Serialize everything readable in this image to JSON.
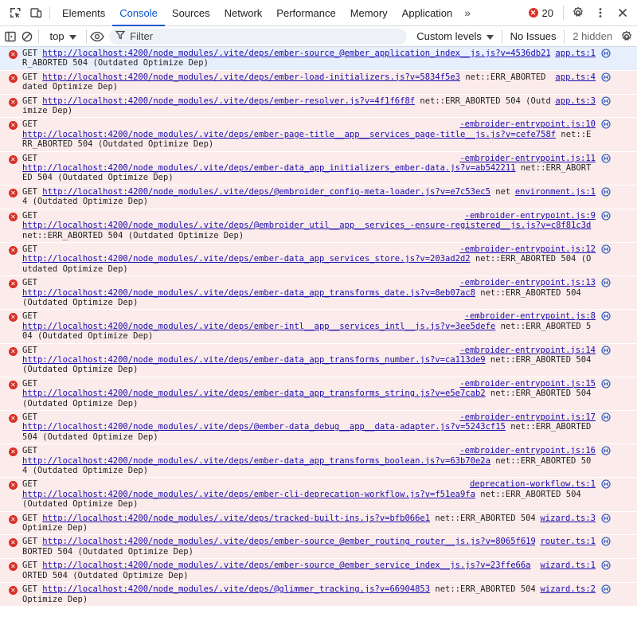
{
  "tabs": [
    {
      "label": "Elements",
      "active": false
    },
    {
      "label": "Console",
      "active": true
    },
    {
      "label": "Sources",
      "active": false
    },
    {
      "label": "Network",
      "active": false
    },
    {
      "label": "Performance",
      "active": false
    },
    {
      "label": "Memory",
      "active": false
    },
    {
      "label": "Application",
      "active": false
    }
  ],
  "topbar": {
    "more_tabs": "»",
    "error_count": "20",
    "icons": [
      "inspect-element-icon",
      "device-toolbar-icon",
      "settings-icon",
      "more-vert-icon",
      "close-icon"
    ]
  },
  "toolbar": {
    "context": "top",
    "filter_placeholder": "Filter",
    "levels": "Custom levels",
    "issues": "No Issues",
    "hidden": "2 hidden"
  },
  "colors": {
    "accent": "#0b57d0",
    "error_bg": "#fcebeb",
    "selected_bg": "#e8effc",
    "error_icon": "#d93025",
    "link": "#1a0dab"
  },
  "messages": [
    {
      "prefix": "GET ",
      "url": "http://localhost:4200/node_modules/.vite/deps/ember-source_@ember_application_index__js.js?v=4536db21",
      "suffix": "net::ERR_ABORTED 504 (Outdated Optimize Dep)",
      "source": "app.ts:1",
      "newline_after_get": false
    },
    {
      "prefix": "GET ",
      "url": "http://localhost:4200/node_modules/.vite/deps/ember-load-initializers.js?v=5834f5e3",
      "suffix": "net::ERR_ABORTED 504 (Outdated Optimize Dep)",
      "source": "app.ts:4",
      "newline_after_get": false
    },
    {
      "prefix": "GET ",
      "url": "http://localhost:4200/node_modules/.vite/deps/ember-resolver.js?v=4f1f6f8f",
      "suffix": "net::ERR_ABORTED 504 (Outdated Optimize Dep)",
      "source": "app.ts:3",
      "newline_after_get": false
    },
    {
      "prefix": "GET",
      "url": "http://localhost:4200/node_modules/.vite/deps/ember-page-title__app__services_page-title__js.js?v=cefe758f",
      "suffix": "net::ERR_ABORTED 504 (Outdated Optimize Dep)",
      "source": "-embroider-entrypoint.js:10",
      "newline_after_get": true
    },
    {
      "prefix": "GET",
      "url": "http://localhost:4200/node_modules/.vite/deps/ember-data_app_initializers_ember-data.js?v=ab542211",
      "suffix": "net::ERR_ABORTED 504 (Outdated Optimize Dep)",
      "source": "-embroider-entrypoint.js:11",
      "newline_after_get": true
    },
    {
      "prefix": "GET ",
      "url": "http://localhost:4200/node_modules/.vite/deps/@embroider_config-meta-loader.js?v=e7c53ec5",
      "suffix": "net::ERR_ABORTED 504 (Outdated Optimize Dep)",
      "source": "environment.js:1",
      "newline_after_get": false
    },
    {
      "prefix": "GET",
      "url": "http://localhost:4200/node_modules/.vite/deps/@embroider_util__app__services_-ensure-registered__js.js?v=c8f81c3d",
      "suffix": "net::ERR_ABORTED 504 (Outdated Optimize Dep)",
      "source": "-embroider-entrypoint.js:9",
      "newline_after_get": true
    },
    {
      "prefix": "GET",
      "url": "http://localhost:4200/node_modules/.vite/deps/ember-data_app_services_store.js?v=203ad2d2",
      "suffix": "net::ERR_ABORTED 504 (Outdated Optimize Dep)",
      "source": "-embroider-entrypoint.js:12",
      "newline_after_get": true
    },
    {
      "prefix": "GET",
      "url": "http://localhost:4200/node_modules/.vite/deps/ember-data_app_transforms_date.js?v=8eb07ac8",
      "suffix": "net::ERR_ABORTED 504 (Outdated Optimize Dep)",
      "source": "-embroider-entrypoint.js:13",
      "newline_after_get": true
    },
    {
      "prefix": "GET",
      "url": "http://localhost:4200/node_modules/.vite/deps/ember-intl__app__services_intl__js.js?v=3ee5defe",
      "suffix": "net::ERR_ABORTED 504 (Outdated Optimize Dep)",
      "source": "-embroider-entrypoint.js:8",
      "newline_after_get": true
    },
    {
      "prefix": "GET",
      "url": "http://localhost:4200/node_modules/.vite/deps/ember-data_app_transforms_number.js?v=ca113de9",
      "suffix": "net::ERR_ABORTED 504 (Outdated Optimize Dep)",
      "source": "-embroider-entrypoint.js:14",
      "newline_after_get": true
    },
    {
      "prefix": "GET",
      "url": "http://localhost:4200/node_modules/.vite/deps/ember-data_app_transforms_string.js?v=e5e7cab2",
      "suffix": "net::ERR_ABORTED 504 (Outdated Optimize Dep)",
      "source": "-embroider-entrypoint.js:15",
      "newline_after_get": true
    },
    {
      "prefix": "GET",
      "url": "http://localhost:4200/node_modules/.vite/deps/@ember-data_debug__app__data-adapter.js?v=5243cf15",
      "suffix": "net::ERR_ABORTED 504 (Outdated Optimize Dep)",
      "source": "-embroider-entrypoint.js:17",
      "newline_after_get": true
    },
    {
      "prefix": "GET",
      "url": "http://localhost:4200/node_modules/.vite/deps/ember-data_app_transforms_boolean.js?v=63b70e2a",
      "suffix": "net::ERR_ABORTED 504 (Outdated Optimize Dep)",
      "source": "-embroider-entrypoint.js:16",
      "newline_after_get": true
    },
    {
      "prefix": "GET",
      "url": "http://localhost:4200/node_modules/.vite/deps/ember-cli-deprecation-workflow.js?v=f51ea9fa",
      "suffix": "net::ERR_ABORTED 504 (Outdated Optimize Dep)",
      "source": "deprecation-workflow.ts:1",
      "newline_after_get": true
    },
    {
      "prefix": "GET ",
      "url": "http://localhost:4200/node_modules/.vite/deps/tracked-built-ins.js?v=bfb066e1",
      "suffix": "net::ERR_ABORTED 504 (Outdated Optimize Dep)",
      "source": "wizard.ts:3",
      "newline_after_get": false
    },
    {
      "prefix": "GET ",
      "url": "http://localhost:4200/node_modules/.vite/deps/ember-source_@ember_routing_router__js.js?v=8065f619",
      "suffix": "net::ERR_ABORTED 504 (Outdated Optimize Dep)",
      "source": "router.ts:1",
      "newline_after_get": false
    },
    {
      "prefix": "GET ",
      "url": "http://localhost:4200/node_modules/.vite/deps/ember-source_@ember_service_index__js.js?v=23ffe66a",
      "suffix": "net::ERR_ABORTED 504 (Outdated Optimize Dep)",
      "source": "wizard.ts:1",
      "newline_after_get": false
    },
    {
      "prefix": "GET ",
      "url": "http://localhost:4200/node_modules/.vite/deps/@glimmer_tracking.js?v=66904853",
      "suffix": "net::ERR_ABORTED 504 (Outdated Optimize Dep)",
      "source": "wizard.ts:2",
      "newline_after_get": false
    }
  ]
}
